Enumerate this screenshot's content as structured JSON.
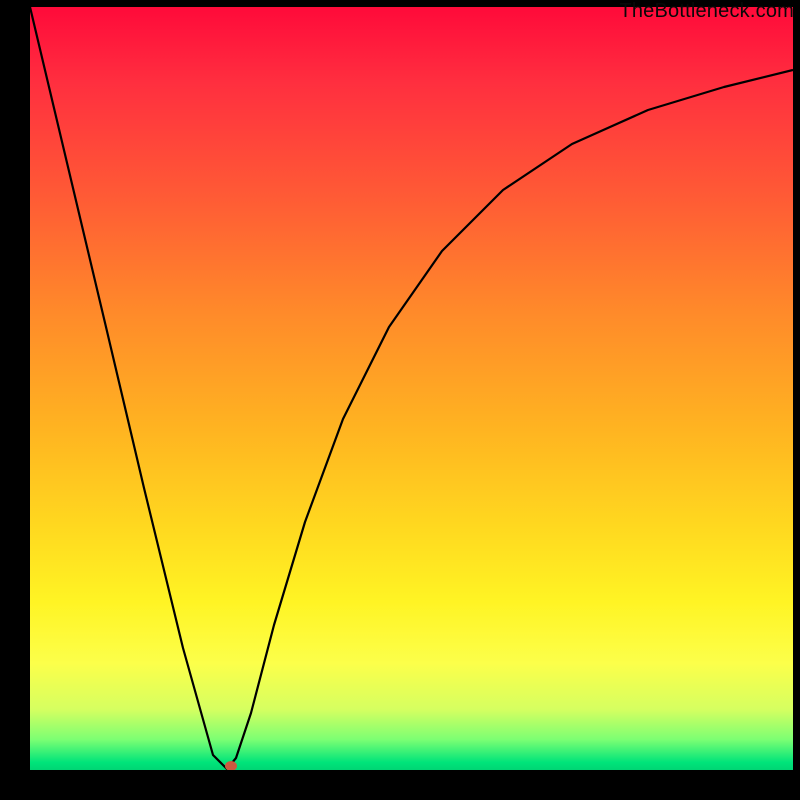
{
  "watermark": "TheBottleneck.com",
  "chart_data": {
    "type": "line",
    "title": "",
    "xlabel": "",
    "ylabel": "",
    "xlim": [
      0,
      1
    ],
    "ylim": [
      0,
      1
    ],
    "series": [
      {
        "name": "bottleneck-curve",
        "x": [
          0.0,
          0.05,
          0.1,
          0.15,
          0.2,
          0.24,
          0.258,
          0.27,
          0.29,
          0.32,
          0.36,
          0.41,
          0.47,
          0.54,
          0.62,
          0.71,
          0.81,
          0.91,
          1.0
        ],
        "values": [
          1.0,
          0.79,
          0.58,
          0.37,
          0.16,
          0.02,
          0.0,
          0.015,
          0.075,
          0.19,
          0.325,
          0.46,
          0.58,
          0.68,
          0.76,
          0.82,
          0.865,
          0.895,
          0.917
        ]
      }
    ],
    "annotations": [
      {
        "name": "min-marker",
        "x": 0.258,
        "y": 0.0,
        "color": "#cb5a3f",
        "shape": "ellipse"
      }
    ],
    "background": {
      "type": "vertical-gradient",
      "stops": [
        {
          "pos": 0.0,
          "color": "#ff0a3a"
        },
        {
          "pos": 0.55,
          "color": "#ffb321"
        },
        {
          "pos": 0.85,
          "color": "#fcff4a"
        },
        {
          "pos": 1.0,
          "color": "#00d574"
        }
      ]
    }
  }
}
